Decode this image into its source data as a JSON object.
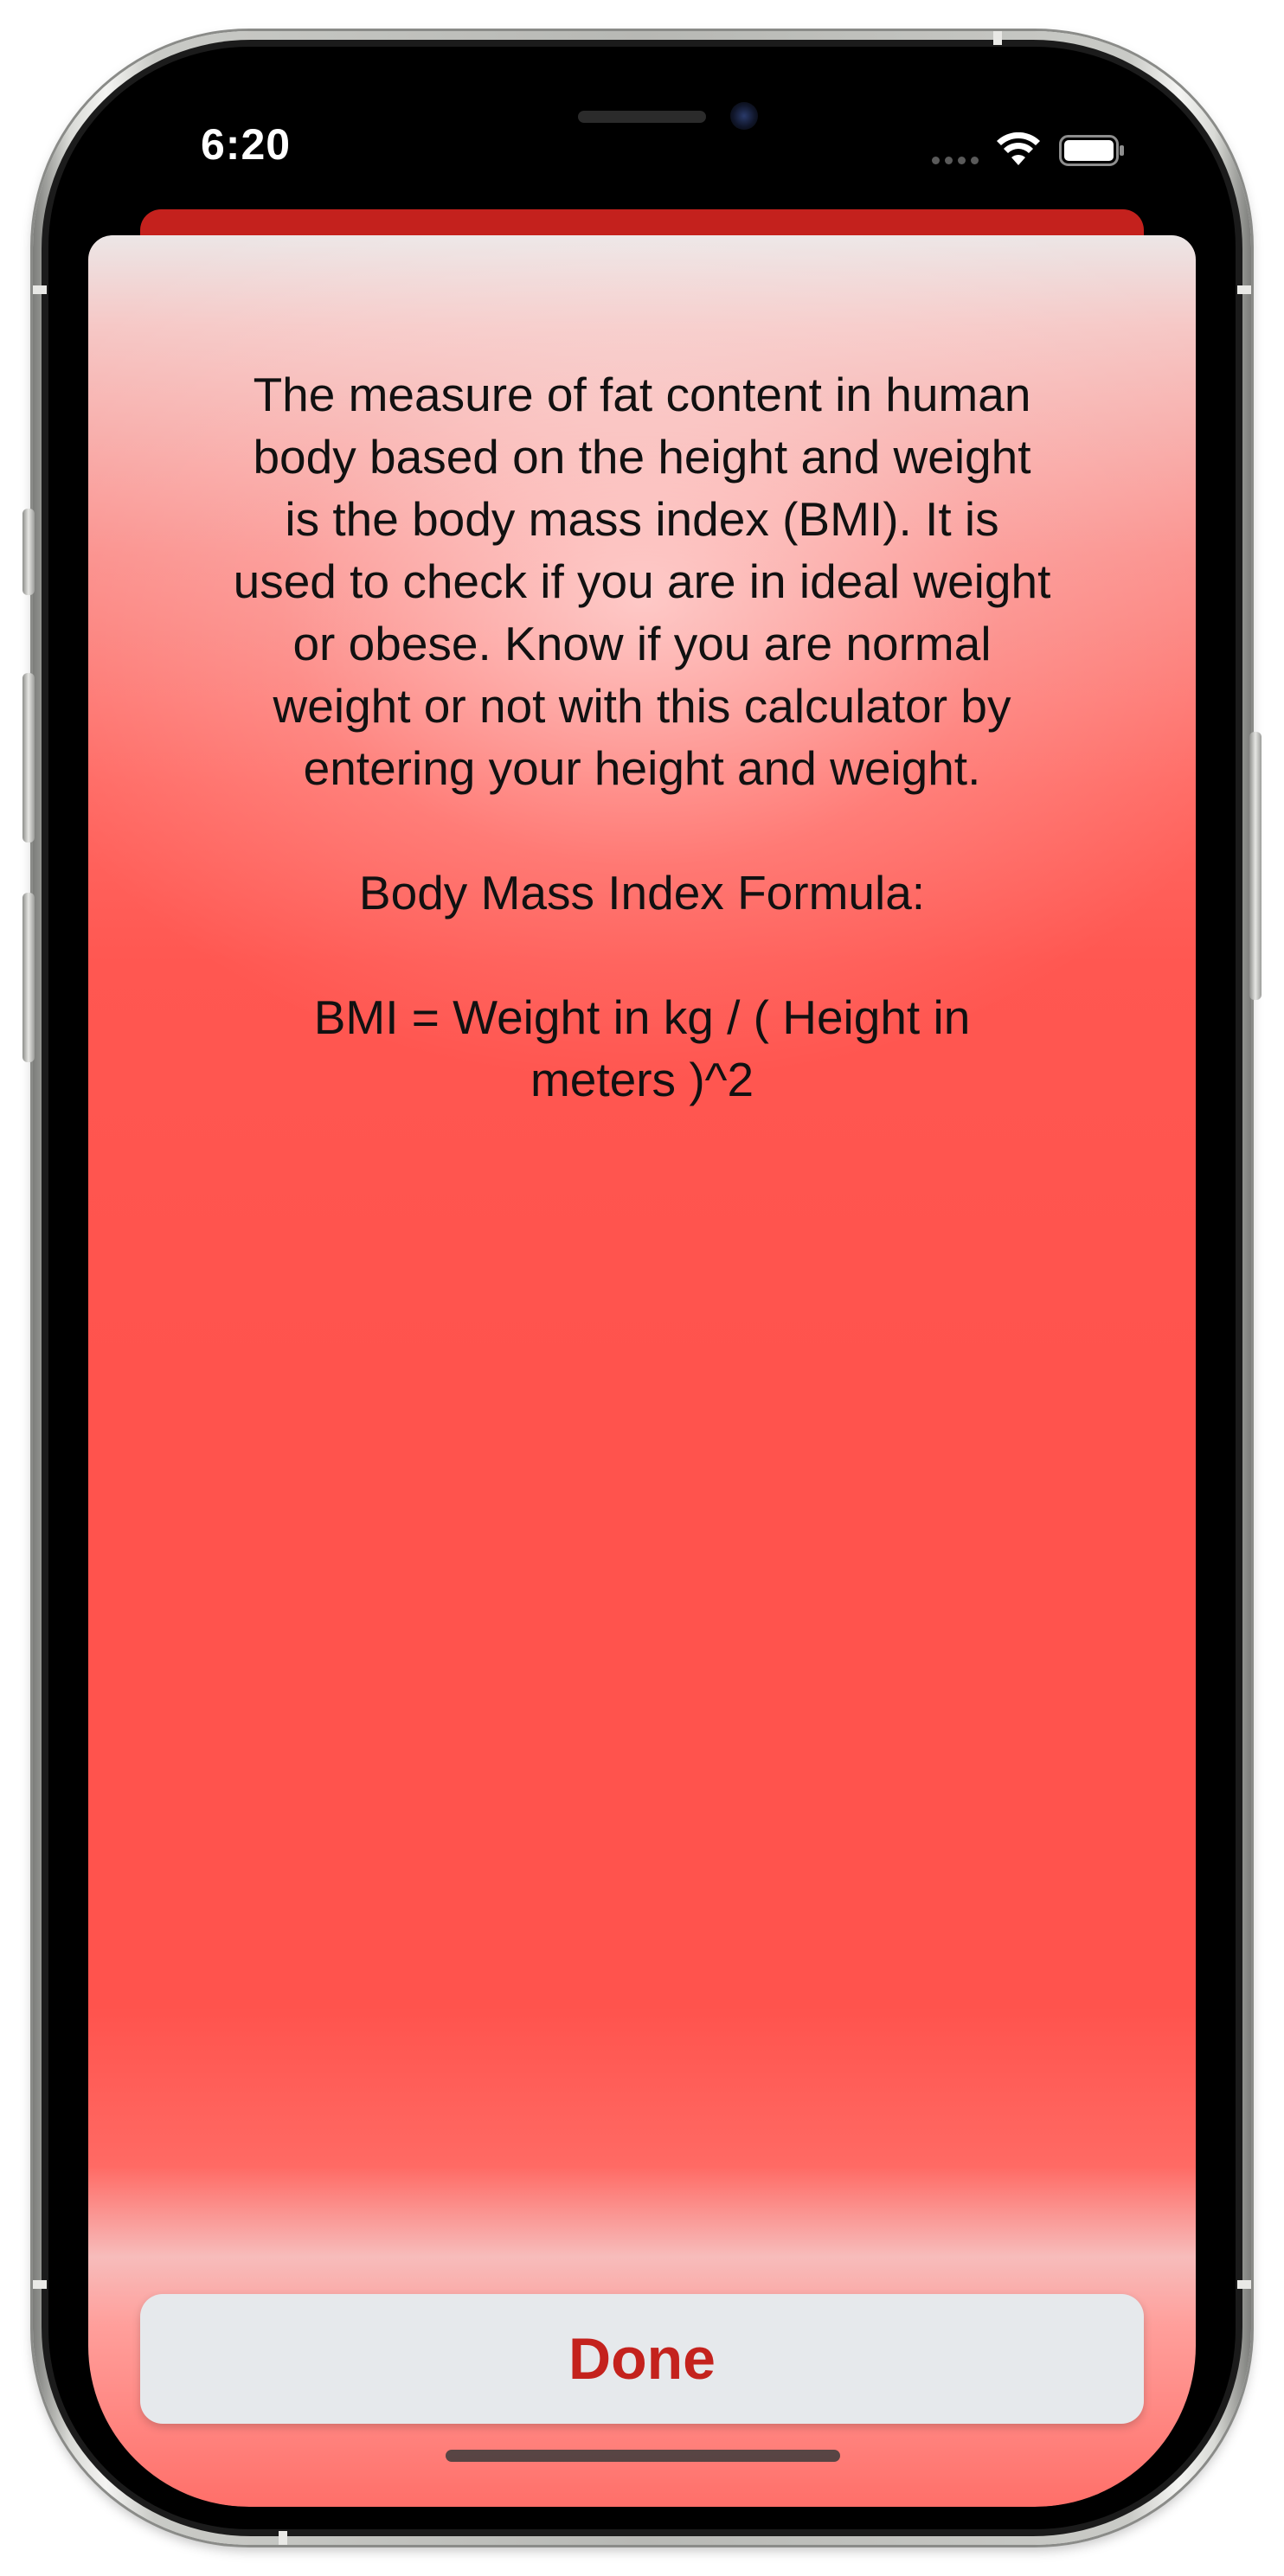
{
  "status_bar": {
    "time": "6:20",
    "icons": [
      "cellular-signal-icon",
      "wifi-icon",
      "battery-icon"
    ]
  },
  "sheet": {
    "description": [
      "The measure of fat content in human",
      "body based on the height and weight",
      "is the body mass index (BMI). It is",
      "used to check if you are in ideal weight",
      "or obese. Know if you are normal",
      "weight or not with this calculator by",
      "entering your height and weight."
    ],
    "formula_heading": "Body Mass Index Formula:",
    "formula": [
      "BMI = Weight in kg / ( Height in",
      "meters )^2"
    ],
    "done_label": "Done"
  },
  "colors": {
    "accent": "#c4211d",
    "sheet_background": "#ff534d",
    "button_background": "#e6e9ec"
  }
}
